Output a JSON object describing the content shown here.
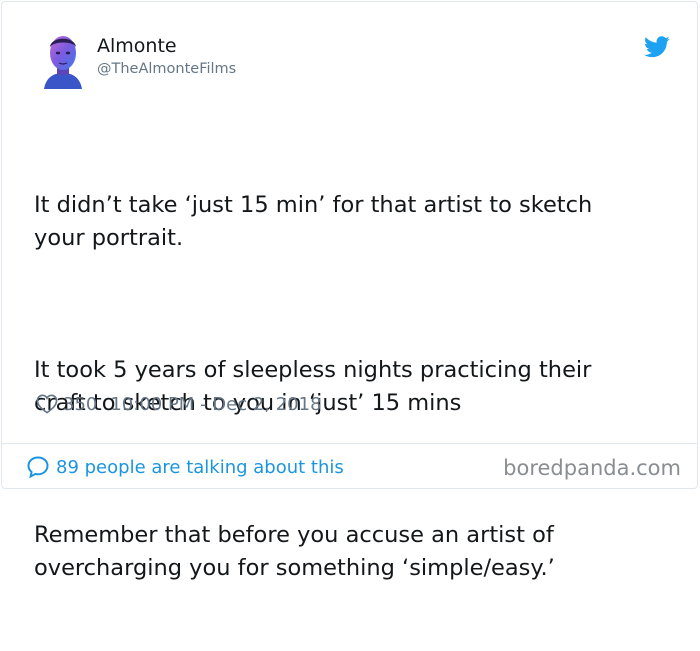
{
  "user": {
    "name": "Almonte",
    "handle": "@TheAlmonteFilms"
  },
  "tweet": {
    "paragraphs": [
      "It didn’t take ‘just 15 min’ for that artist to sketch\nyour portrait.",
      "It took 5 years of sleepless nights practicing their\ncraft to sketch to you in ‘just’ 15 mins",
      "Remember that before you accuse an artist of\novercharging you for something ‘simple/easy.’"
    ],
    "likes": "350",
    "timestamp": "10:00 PM - Dec 2, 2018"
  },
  "footer": {
    "talking": "89 people are talking about this",
    "watermark": "boredpanda.com"
  },
  "icons": {
    "brand": "twitter-bird-icon",
    "like": "heart-icon",
    "reply": "speech-bubble-icon"
  },
  "colors": {
    "twitter_blue": "#1da1f2",
    "link_blue": "#1b95e0",
    "muted_gray": "#657786",
    "text": "#14171a"
  }
}
